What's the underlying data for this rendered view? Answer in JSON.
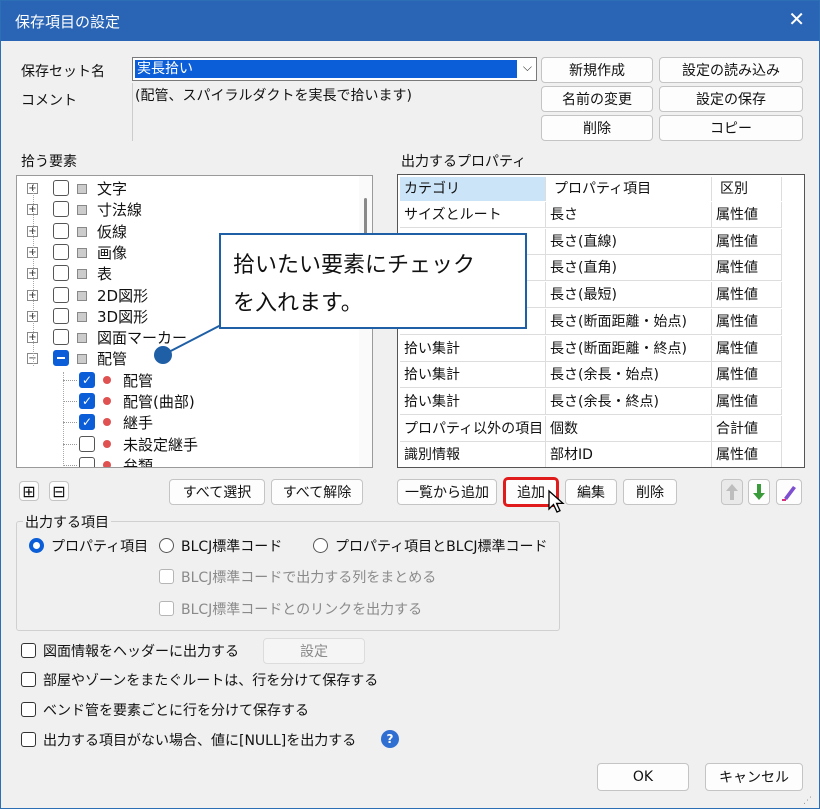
{
  "title": "保存項目の設定",
  "close_glyph": "✕",
  "set_name_label": "保存セット名",
  "set_name_value": "実長拾い",
  "comment_label": "コメント",
  "comment_value": "(配管、スパイラルダクトを実長で拾います)",
  "top_buttons": {
    "new": "新規作成",
    "load": "設定の読み込み",
    "rename": "名前の変更",
    "save": "設定の保存",
    "delete": "削除",
    "copy": "コピー"
  },
  "tree_label": "拾う要素",
  "tree_items": [
    {
      "label": "文字",
      "state": "off"
    },
    {
      "label": "寸法線",
      "state": "off"
    },
    {
      "label": "仮線",
      "state": "off"
    },
    {
      "label": "画像",
      "state": "off"
    },
    {
      "label": "表",
      "state": "off"
    },
    {
      "label": "2D図形",
      "state": "off"
    },
    {
      "label": "3D図形",
      "state": "off"
    },
    {
      "label": "図面マーカー",
      "state": "off"
    },
    {
      "label": "配管",
      "state": "partial"
    },
    {
      "label": "配管",
      "state": "on"
    },
    {
      "label": "配管(曲部)",
      "state": "on"
    },
    {
      "label": "継手",
      "state": "on"
    },
    {
      "label": "未設定継手",
      "state": "off"
    },
    {
      "label": "弁類",
      "state": "off"
    }
  ],
  "tree_buttons": {
    "expand": "⊞",
    "collapse": "⊟",
    "select_all": "すべて選択",
    "clear_all": "すべて解除"
  },
  "callout": {
    "line1": "拾いたい要素にチェック",
    "line2": "を入れます。"
  },
  "props_label": "出力するプロパティ",
  "table": {
    "headers": [
      "カテゴリ",
      "プロパティ項目",
      "区別"
    ],
    "rows": [
      [
        "サイズとルート",
        "長さ",
        "属性値"
      ],
      [
        "",
        "長さ(直線)",
        "属性値"
      ],
      [
        "",
        "長さ(直角)",
        "属性値"
      ],
      [
        "",
        "長さ(最短)",
        "属性値"
      ],
      [
        "",
        "長さ(断面距離・始点)",
        "属性値"
      ],
      [
        "拾い集計",
        "長さ(断面距離・終点)",
        "属性値"
      ],
      [
        "拾い集計",
        "長さ(余長・始点)",
        "属性値"
      ],
      [
        "拾い集計",
        "長さ(余長・終点)",
        "属性値"
      ],
      [
        "プロパティ以外の項目",
        "個数",
        "合計値"
      ],
      [
        "識別情報",
        "部材ID",
        "属性値"
      ]
    ]
  },
  "table_buttons": {
    "add_from_list": "一覧から追加",
    "add": "追加",
    "edit": "編集",
    "delete": "削除"
  },
  "output_group": {
    "title": "出力する項目",
    "radios": [
      "プロパティ項目",
      "BLCJ標準コード",
      "プロパティ項目とBLCJ標準コード"
    ],
    "sub_checks": [
      "BLCJ標準コードで出力する列をまとめる",
      "BLCJ標準コードとのリンクを出力する"
    ]
  },
  "options": [
    "図面情報をヘッダーに出力する",
    "部屋やゾーンをまたぐルートは、行を分けて保存する",
    "ベンド管を要素ごとに行を分けて保存する",
    "出力する項目がない場合、値に[NULL]を出力する"
  ],
  "settings_button": "設定",
  "ok": "OK",
  "cancel": "キャンセル",
  "colors": {
    "accent": "#0b5ed7",
    "titlebar": "#2a64b4",
    "highlight_border": "#e01b1b",
    "callout_border": "#1f5fa6"
  }
}
